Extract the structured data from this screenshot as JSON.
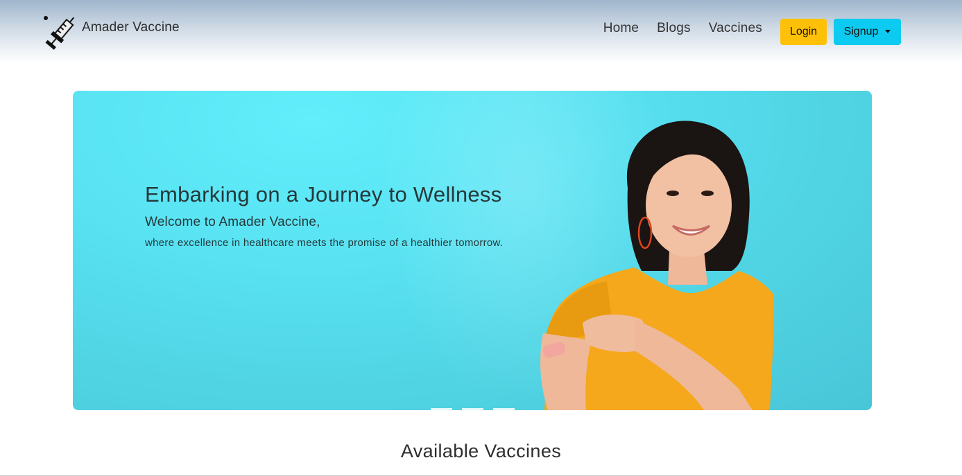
{
  "brand": {
    "name": "Amader Vaccine",
    "logo_icon": "syringe-icon"
  },
  "nav": {
    "links": [
      {
        "label": "Home"
      },
      {
        "label": "Blogs"
      },
      {
        "label": "Vaccines"
      }
    ],
    "login_label": "Login",
    "signup_label": "Signup"
  },
  "hero": {
    "title": "Embarking on a Journey to Wellness",
    "subtitle": "Welcome to Amader Vaccine,",
    "description": "where excellence in healthcare meets the promise of a healthier tomorrow.",
    "slides": 3,
    "active_slide": 1
  },
  "section": {
    "title": "Available Vaccines"
  },
  "colors": {
    "login_button": "#ffc107",
    "signup_button": "#0dcaf0",
    "hero_background": "#58e2f2",
    "shirt": "#f5a81c"
  }
}
